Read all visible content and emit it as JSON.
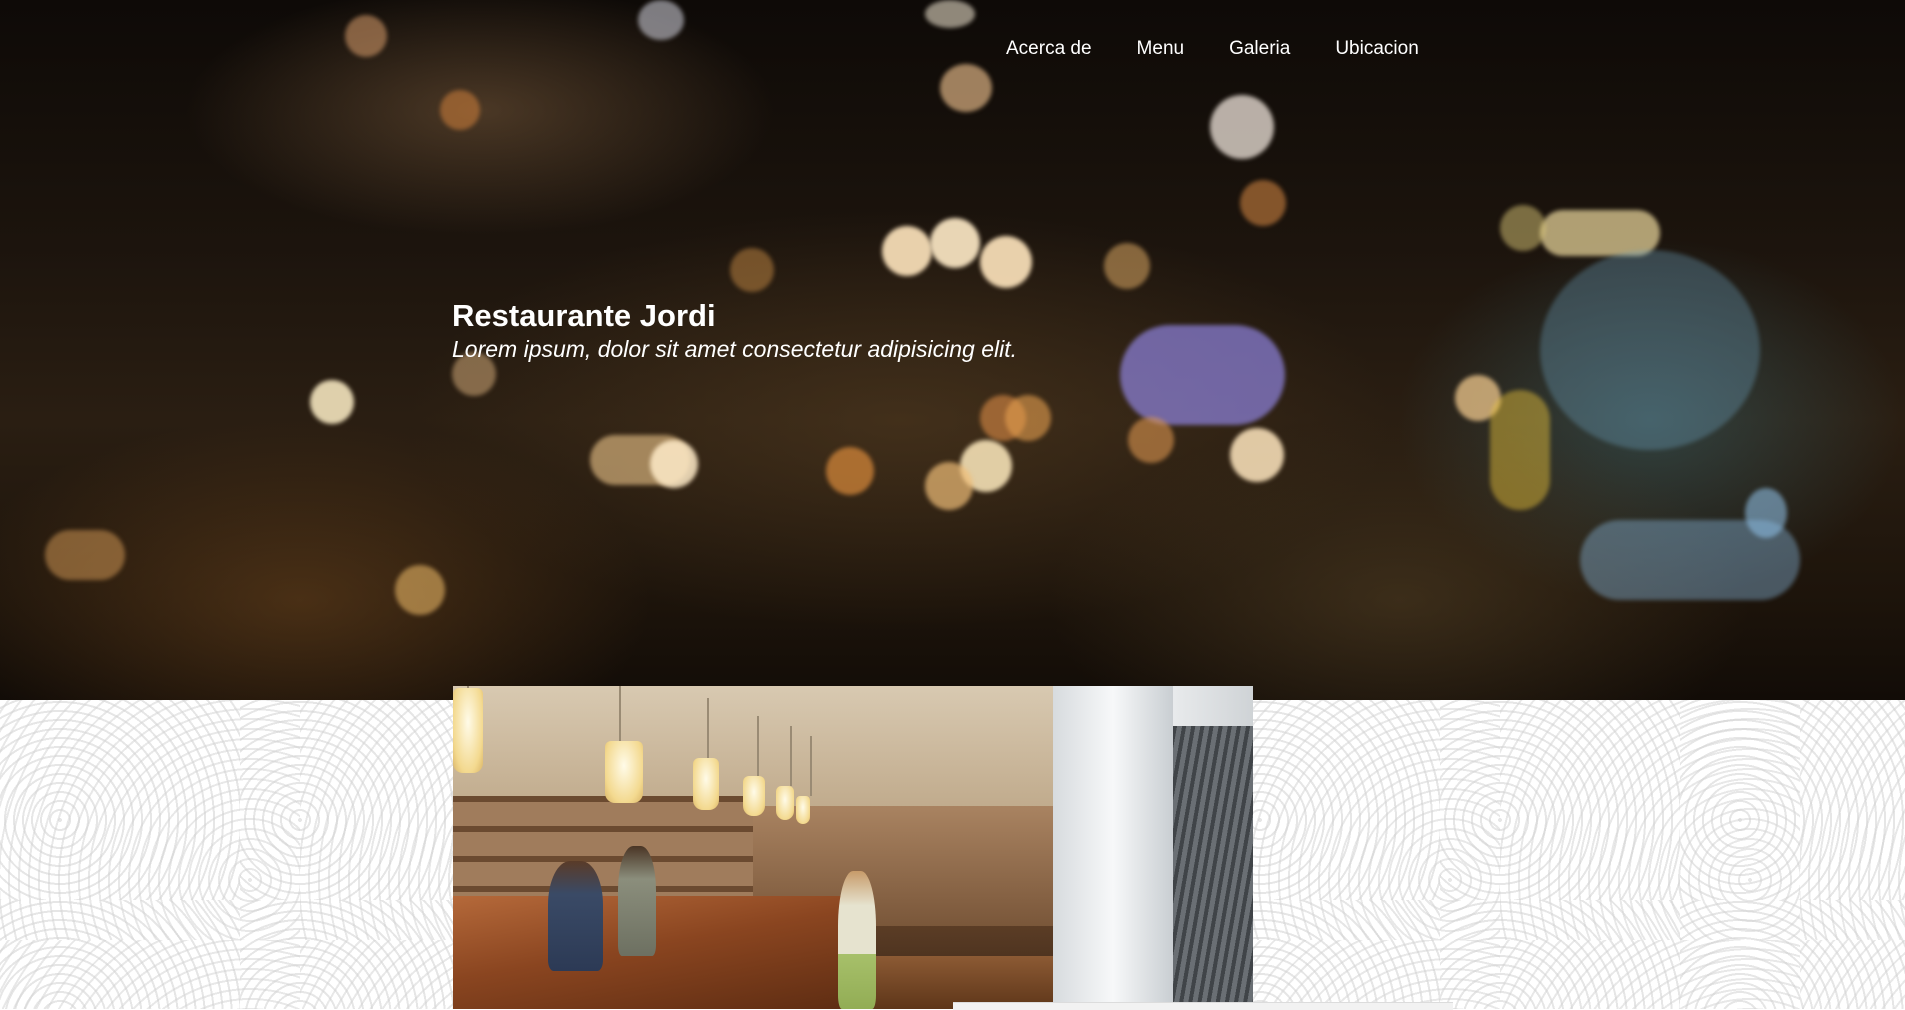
{
  "nav": {
    "items": [
      {
        "label": "Acerca de"
      },
      {
        "label": "Menu"
      },
      {
        "label": "Galeria"
      },
      {
        "label": "Ubicacion"
      }
    ]
  },
  "hero": {
    "title": "Restaurante Jordi",
    "subtitle": "Lorem ipsum, dolor sit amet consectetur adipisicing elit."
  }
}
